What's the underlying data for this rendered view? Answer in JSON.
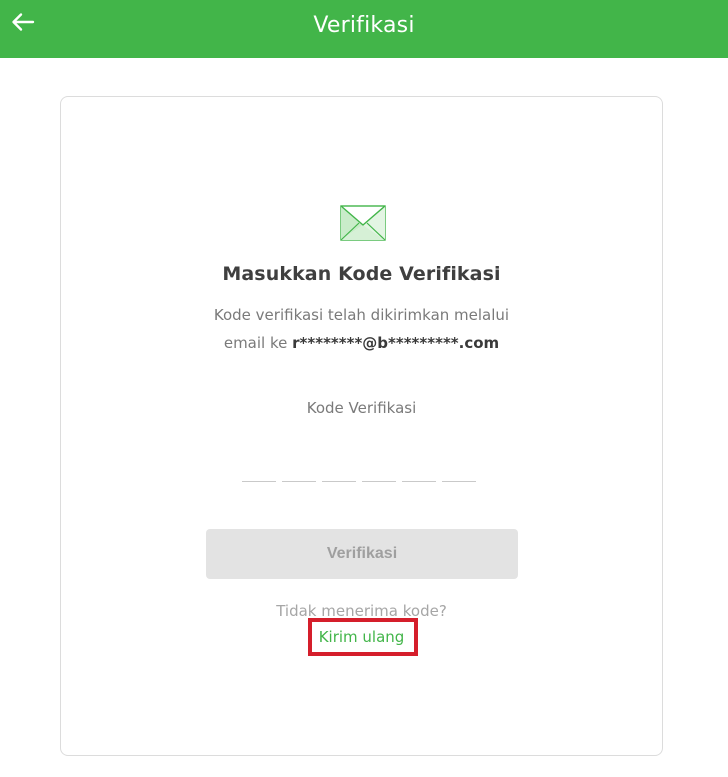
{
  "header": {
    "back_icon": "arrow-left-icon",
    "title": "Verifikasi",
    "background_color": "#42b549"
  },
  "card": {
    "icon": "envelope-icon",
    "heading": "Masukkan Kode Verifikasi",
    "description_line1": "Kode verifikasi telah dikirimkan melalui",
    "description_line2_prefix": "email ke",
    "masked_email": "r********@b*********.com",
    "code_label": "Kode Verifikasi",
    "code_slots": [
      "",
      "",
      "",
      "",
      "",
      ""
    ],
    "verify_button_label": "Verifikasi",
    "no_code_text": "Tidak menerima kode?",
    "resend_label": "Kirim ulang",
    "accent_color": "#42b549",
    "highlight_color": "#d51e2b"
  }
}
